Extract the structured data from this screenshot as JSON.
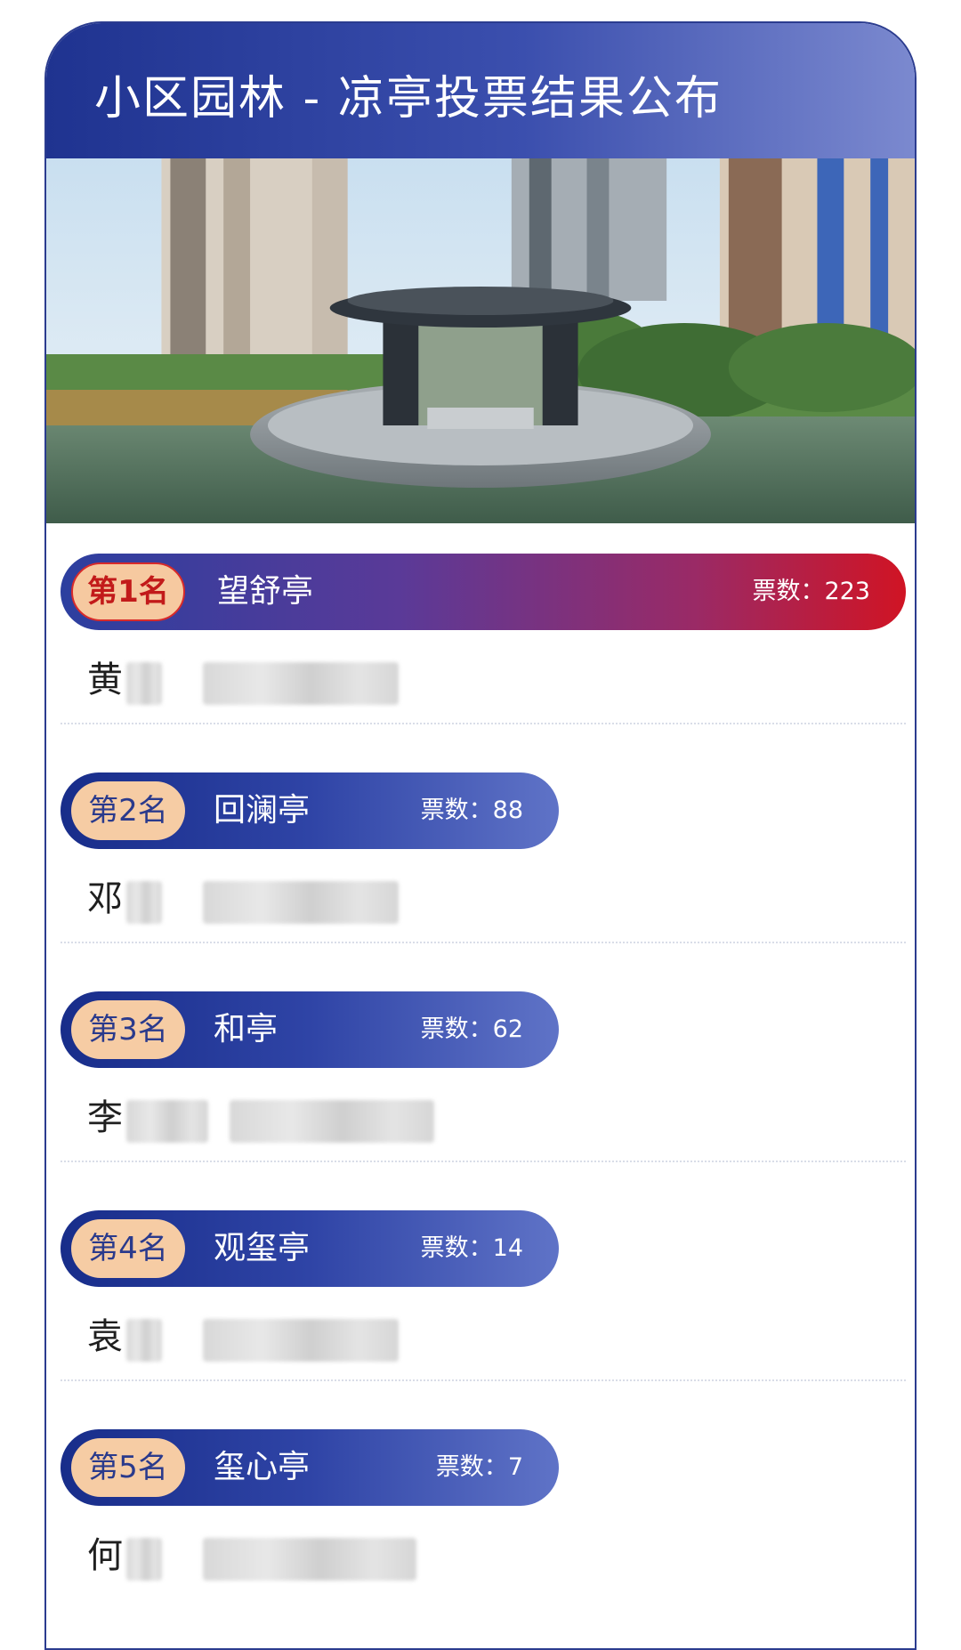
{
  "header": {
    "title": "小区园林 - 凉亭投票结果公布"
  },
  "photo": {
    "alt": "pavilion-photo"
  },
  "ranking": [
    {
      "rank": "第1名",
      "pavilion": "望舒亭",
      "votes_label": "票数：",
      "votes": "223",
      "voter_surname": "黄"
    },
    {
      "rank": "第2名",
      "pavilion": "回澜亭",
      "votes_label": "票数：",
      "votes": "88",
      "voter_surname": "邓"
    },
    {
      "rank": "第3名",
      "pavilion": "和亭",
      "votes_label": "票数：",
      "votes": "62",
      "voter_surname": "李"
    },
    {
      "rank": "第4名",
      "pavilion": "观玺亭",
      "votes_label": "票数：",
      "votes": "14",
      "voter_surname": "袁"
    },
    {
      "rank": "第5名",
      "pavilion": "玺心亭",
      "votes_label": "票数：",
      "votes": "7",
      "voter_surname": "何"
    }
  ],
  "colors": {
    "header_start": "#1f3390",
    "header_end": "#7b89cf",
    "first_place_end": "#d01424",
    "badge": "#f6cca4"
  }
}
